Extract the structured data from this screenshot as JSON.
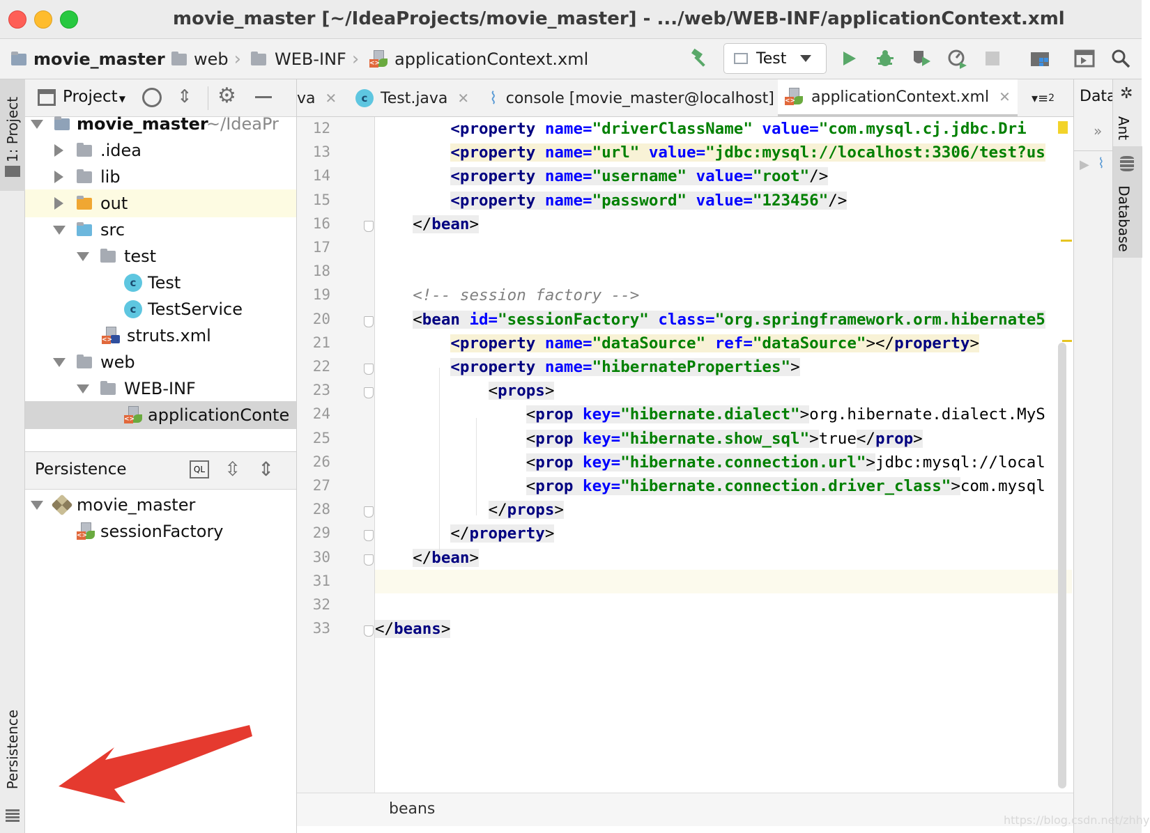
{
  "window": {
    "title": "movie_master [~/IdeaProjects/movie_master] - .../web/WEB-INF/applicationContext.xml"
  },
  "navbar": {
    "breadcrumbs": [
      "movie_master",
      "web",
      "WEB-INF",
      "applicationContext.xml"
    ],
    "run_config": "Test"
  },
  "left_stripe": {
    "project_tab": "1: Project",
    "persistence_tab": "Persistence"
  },
  "project_panel": {
    "header": "Project",
    "tree": [
      {
        "label": "movie_master",
        "hint": "~/IdeaPr",
        "icon": "module-folder-icon"
      },
      {
        "label": ".idea",
        "icon": "folder-icon"
      },
      {
        "label": "lib",
        "icon": "folder-icon"
      },
      {
        "label": "out",
        "icon": "excluded-folder-icon"
      },
      {
        "label": "src",
        "icon": "source-folder-icon"
      },
      {
        "label": "test",
        "icon": "package-icon"
      },
      {
        "label": "Test",
        "icon": "class-icon"
      },
      {
        "label": "TestService",
        "icon": "class-icon"
      },
      {
        "label": "struts.xml",
        "icon": "struts-xml-icon"
      },
      {
        "label": "web",
        "icon": "web-folder-icon"
      },
      {
        "label": "WEB-INF",
        "icon": "folder-icon"
      },
      {
        "label": "applicationConte",
        "icon": "spring-xml-icon"
      }
    ]
  },
  "persistence_panel": {
    "header": "Persistence",
    "ql_label": "QL",
    "tree": [
      {
        "label": "movie_master"
      },
      {
        "label": "sessionFactory"
      }
    ]
  },
  "editor": {
    "tabs": [
      "va",
      "Test.java",
      "console [movie_master@localhost]",
      "applicationContext.xml"
    ],
    "tab_overflow": "2",
    "right_panel_label": "Data",
    "line_numbers": [
      "12",
      "13",
      "14",
      "15",
      "16",
      "17",
      "18",
      "19",
      "20",
      "21",
      "22",
      "23",
      "24",
      "25",
      "26",
      "27",
      "28",
      "29",
      "30",
      "31",
      "32",
      "33"
    ],
    "status_breadcrumb": "beans"
  },
  "right_stripe": {
    "ant_tab": "Ant",
    "database_tab": "Database"
  },
  "watermark": "https://blog.csdn.net/zhhy",
  "colors": {
    "tag": "#000080",
    "attr": "#0000ff",
    "value": "#008000",
    "comment": "#808080",
    "annotation_arrow": "#e53a2f"
  }
}
